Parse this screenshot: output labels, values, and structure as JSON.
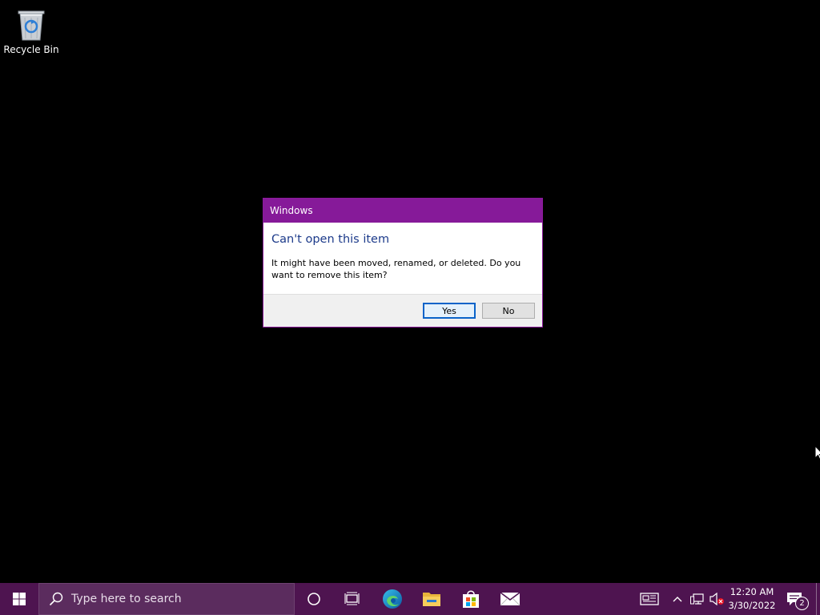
{
  "desktop": {
    "icons": [
      {
        "label": "Recycle Bin",
        "icon": "recycle-bin-icon"
      }
    ]
  },
  "dialog": {
    "title": "Windows",
    "heading": "Can't open this item",
    "message": "It might have been moved, renamed, or deleted. Do you want to remove this item?",
    "yes_label": "Yes",
    "no_label": "No",
    "accent_color": "#861a99"
  },
  "taskbar": {
    "search_placeholder": "Type here to search",
    "pinned": [
      "start-icon",
      "cortana-icon",
      "task-view-icon",
      "edge-icon",
      "file-explorer-icon",
      "microsoft-store-icon",
      "mail-icon"
    ],
    "tray": {
      "time": "12:20 AM",
      "date": "3/30/2022",
      "notification_count": "2"
    },
    "color": "#4e1450"
  }
}
